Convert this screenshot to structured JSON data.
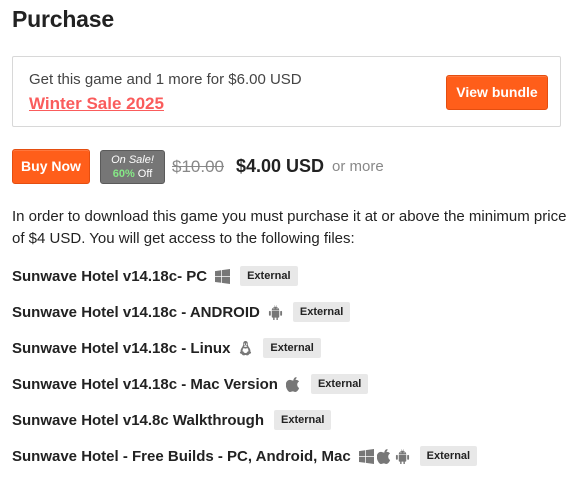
{
  "page": {
    "title": "Purchase"
  },
  "bundle": {
    "text": "Get this game and 1 more for $6.00 USD",
    "link_label": "Winter Sale 2025",
    "button_label": "View bundle"
  },
  "purchase": {
    "buy_label": "Buy Now",
    "sale_badge": {
      "line1": "On Sale!",
      "percent": "60%",
      "off": "Off"
    },
    "original_price": "$10.00",
    "sale_price": "$4.00 USD",
    "or_more": "or more"
  },
  "description": "In order to download this game you must purchase it at or above the minimum price of $4 USD. You will get access to the following files:",
  "files": [
    {
      "name": "Sunwave Hotel v14.18c- PC",
      "platforms": [
        "windows-icon"
      ],
      "tag": "External"
    },
    {
      "name": "Sunwave Hotel v14.18c - ANDROID",
      "platforms": [
        "android-icon"
      ],
      "tag": "External"
    },
    {
      "name": "Sunwave Hotel v14.18c - Linux",
      "platforms": [
        "linux-icon"
      ],
      "tag": "External"
    },
    {
      "name": "Sunwave Hotel v14.18c - Mac Version",
      "platforms": [
        "apple-icon"
      ],
      "tag": "External"
    },
    {
      "name": "Sunwave Hotel v14.8c Walkthrough",
      "platforms": [],
      "tag": "External"
    },
    {
      "name": "Sunwave Hotel - Free Builds - PC, Android, Mac",
      "platforms": [
        "windows-icon",
        "apple-icon",
        "android-icon"
      ],
      "tag": "External"
    }
  ],
  "colors": {
    "accent": "#ff5e1a",
    "link": "#fa5c5c",
    "badge_bg": "#767676",
    "badge_percent": "#86e886",
    "tag_bg": "#e8e8e8"
  }
}
